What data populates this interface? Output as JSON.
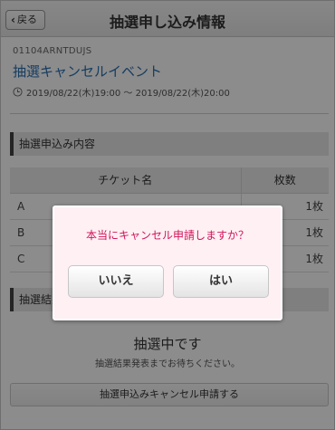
{
  "header": {
    "back_label": "戻る",
    "title": "抽選申し込み情報"
  },
  "event": {
    "code": "01104ARNTDUJS",
    "name": "抽選キャンセルイベント",
    "date_range": "2019/08/22(木)19:00 〜 2019/08/22(木)20:00"
  },
  "sections": {
    "application": "抽選申込み内容",
    "result": "抽選結果"
  },
  "table": {
    "headers": [
      "チケット名",
      "枚数"
    ],
    "rows": [
      {
        "name": "A",
        "qty": "1枚"
      },
      {
        "name": "B",
        "qty": "1枚"
      },
      {
        "name": "C",
        "qty": "1枚"
      }
    ]
  },
  "status": {
    "title": "抽選中です",
    "note": "抽選結果発表までお待ちください。",
    "cancel_button": "抽選申込みキャンセル申請する"
  },
  "dialog": {
    "message": "本当にキャンセル申請しますか？",
    "no_label": "いいえ",
    "yes_label": "はい"
  },
  "colors": {
    "link_blue": "#2a6fb0",
    "dialog_text": "#d0145a",
    "dialog_bg": "#fff0f4"
  }
}
